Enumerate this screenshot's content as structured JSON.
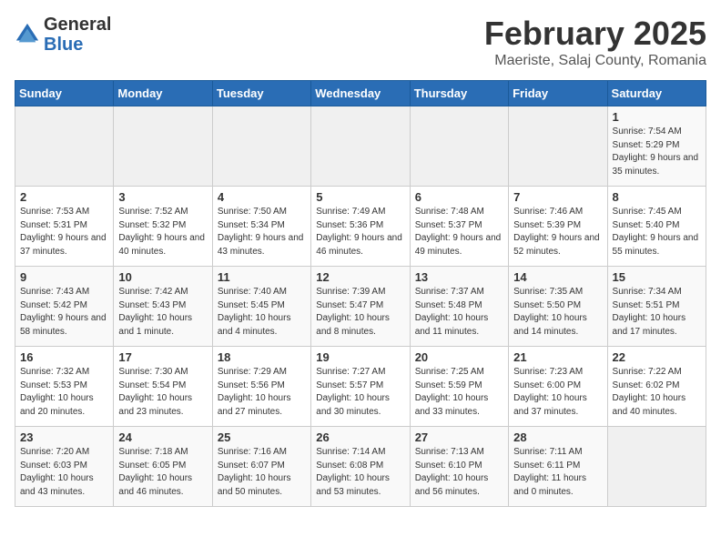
{
  "header": {
    "logo_general": "General",
    "logo_blue": "Blue",
    "title": "February 2025",
    "subtitle": "Maeriste, Salaj County, Romania"
  },
  "calendar": {
    "days_of_week": [
      "Sunday",
      "Monday",
      "Tuesday",
      "Wednesday",
      "Thursday",
      "Friday",
      "Saturday"
    ],
    "weeks": [
      [
        {
          "day": "",
          "info": ""
        },
        {
          "day": "",
          "info": ""
        },
        {
          "day": "",
          "info": ""
        },
        {
          "day": "",
          "info": ""
        },
        {
          "day": "",
          "info": ""
        },
        {
          "day": "",
          "info": ""
        },
        {
          "day": "1",
          "info": "Sunrise: 7:54 AM\nSunset: 5:29 PM\nDaylight: 9 hours and 35 minutes."
        }
      ],
      [
        {
          "day": "2",
          "info": "Sunrise: 7:53 AM\nSunset: 5:31 PM\nDaylight: 9 hours and 37 minutes."
        },
        {
          "day": "3",
          "info": "Sunrise: 7:52 AM\nSunset: 5:32 PM\nDaylight: 9 hours and 40 minutes."
        },
        {
          "day": "4",
          "info": "Sunrise: 7:50 AM\nSunset: 5:34 PM\nDaylight: 9 hours and 43 minutes."
        },
        {
          "day": "5",
          "info": "Sunrise: 7:49 AM\nSunset: 5:36 PM\nDaylight: 9 hours and 46 minutes."
        },
        {
          "day": "6",
          "info": "Sunrise: 7:48 AM\nSunset: 5:37 PM\nDaylight: 9 hours and 49 minutes."
        },
        {
          "day": "7",
          "info": "Sunrise: 7:46 AM\nSunset: 5:39 PM\nDaylight: 9 hours and 52 minutes."
        },
        {
          "day": "8",
          "info": "Sunrise: 7:45 AM\nSunset: 5:40 PM\nDaylight: 9 hours and 55 minutes."
        }
      ],
      [
        {
          "day": "9",
          "info": "Sunrise: 7:43 AM\nSunset: 5:42 PM\nDaylight: 9 hours and 58 minutes."
        },
        {
          "day": "10",
          "info": "Sunrise: 7:42 AM\nSunset: 5:43 PM\nDaylight: 10 hours and 1 minute."
        },
        {
          "day": "11",
          "info": "Sunrise: 7:40 AM\nSunset: 5:45 PM\nDaylight: 10 hours and 4 minutes."
        },
        {
          "day": "12",
          "info": "Sunrise: 7:39 AM\nSunset: 5:47 PM\nDaylight: 10 hours and 8 minutes."
        },
        {
          "day": "13",
          "info": "Sunrise: 7:37 AM\nSunset: 5:48 PM\nDaylight: 10 hours and 11 minutes."
        },
        {
          "day": "14",
          "info": "Sunrise: 7:35 AM\nSunset: 5:50 PM\nDaylight: 10 hours and 14 minutes."
        },
        {
          "day": "15",
          "info": "Sunrise: 7:34 AM\nSunset: 5:51 PM\nDaylight: 10 hours and 17 minutes."
        }
      ],
      [
        {
          "day": "16",
          "info": "Sunrise: 7:32 AM\nSunset: 5:53 PM\nDaylight: 10 hours and 20 minutes."
        },
        {
          "day": "17",
          "info": "Sunrise: 7:30 AM\nSunset: 5:54 PM\nDaylight: 10 hours and 23 minutes."
        },
        {
          "day": "18",
          "info": "Sunrise: 7:29 AM\nSunset: 5:56 PM\nDaylight: 10 hours and 27 minutes."
        },
        {
          "day": "19",
          "info": "Sunrise: 7:27 AM\nSunset: 5:57 PM\nDaylight: 10 hours and 30 minutes."
        },
        {
          "day": "20",
          "info": "Sunrise: 7:25 AM\nSunset: 5:59 PM\nDaylight: 10 hours and 33 minutes."
        },
        {
          "day": "21",
          "info": "Sunrise: 7:23 AM\nSunset: 6:00 PM\nDaylight: 10 hours and 37 minutes."
        },
        {
          "day": "22",
          "info": "Sunrise: 7:22 AM\nSunset: 6:02 PM\nDaylight: 10 hours and 40 minutes."
        }
      ],
      [
        {
          "day": "23",
          "info": "Sunrise: 7:20 AM\nSunset: 6:03 PM\nDaylight: 10 hours and 43 minutes."
        },
        {
          "day": "24",
          "info": "Sunrise: 7:18 AM\nSunset: 6:05 PM\nDaylight: 10 hours and 46 minutes."
        },
        {
          "day": "25",
          "info": "Sunrise: 7:16 AM\nSunset: 6:07 PM\nDaylight: 10 hours and 50 minutes."
        },
        {
          "day": "26",
          "info": "Sunrise: 7:14 AM\nSunset: 6:08 PM\nDaylight: 10 hours and 53 minutes."
        },
        {
          "day": "27",
          "info": "Sunrise: 7:13 AM\nSunset: 6:10 PM\nDaylight: 10 hours and 56 minutes."
        },
        {
          "day": "28",
          "info": "Sunrise: 7:11 AM\nSunset: 6:11 PM\nDaylight: 11 hours and 0 minutes."
        },
        {
          "day": "",
          "info": ""
        }
      ]
    ]
  }
}
